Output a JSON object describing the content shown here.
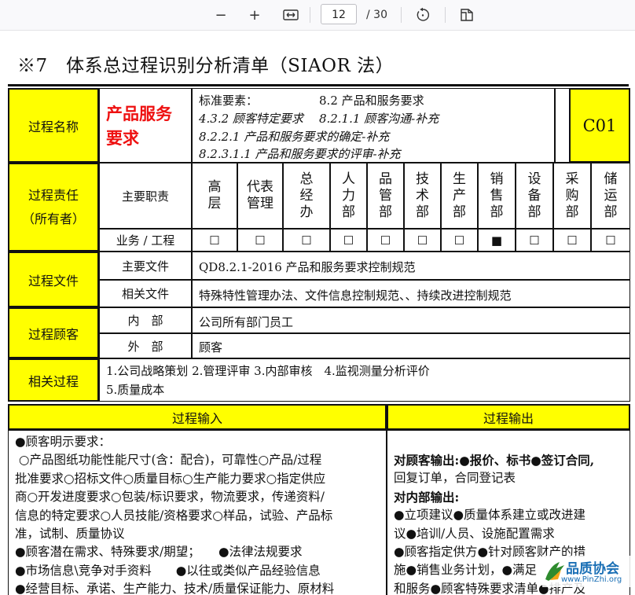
{
  "toolbar": {
    "zoom_out": "−",
    "zoom_in": "+",
    "current_page": "12",
    "total_pages": "/ 30"
  },
  "title": "※7　体系总过程识别分析清单（SIAOR 法）",
  "process_name": {
    "label": "过程名称",
    "name_line1": "产品服务",
    "name_line2": "要求",
    "std_label": "标准要素：",
    "std_main": "8.2 产品和服务要求",
    "std_line2a": "4.3.2 顾客特定要求",
    "std_line2b": "8.2.1.1 顾客沟通-补充",
    "std_line3": "8.2.2.1 产品和服务要求的确定-补充",
    "std_line4": "8.2.3.1.1 产品和服务要求的评审-补充",
    "code": "C01"
  },
  "responsibility": {
    "label_line1": "过程责任",
    "label_line2": "（所有者）",
    "main_duty": "主要职责",
    "business": "业务 / 工程",
    "depts": [
      {
        "name": "高层",
        "mark": "☐"
      },
      {
        "name": "代表 管理",
        "mark": "☐"
      },
      {
        "name": "总经办",
        "mark": "☐"
      },
      {
        "name": "人力部",
        "mark": "☐"
      },
      {
        "name": "品管部",
        "mark": "☐"
      },
      {
        "name": "技术部",
        "mark": "☐"
      },
      {
        "name": "生产部",
        "mark": "☐"
      },
      {
        "name": "销售部",
        "mark": "■"
      },
      {
        "name": "设备部",
        "mark": "☐"
      },
      {
        "name": "采购部",
        "mark": "☐"
      },
      {
        "name": "储运部",
        "mark": "☐"
      }
    ]
  },
  "files": {
    "label": "过程文件",
    "main_label": "主要文件",
    "main_value": "QD8.2.1-2016 产品和服务要求控制规范",
    "related_label": "相关文件",
    "related_value": "特殊特性管理办法、文件信息控制规范、、持续改进控制规范"
  },
  "customers": {
    "label": "过程顾客",
    "internal_label": "内　部",
    "internal_value": "公司所有部门员工",
    "external_label": "外　部",
    "external_value": "顾客"
  },
  "related": {
    "label": "相关过程",
    "line1": "1.公司战略策划 2.管理评审 3.内部审核　4.监视测量分析评价",
    "line2": "5.质量成本"
  },
  "input": {
    "header": "过程输入",
    "lines": [
      "●顾客明示要求：",
      " ○产品图纸功能性能尺寸(含：配合)，可靠性○产品/过程",
      "批准要求○招标文件○质量目标○生产能力要求○指定供应",
      "商○开发进度要求○包装/标识要求，物流要求，传递资料/",
      "信息的特定要求○人员技能/资格要求○样品，试验、产品标",
      "准，试制、质量协议",
      "●顾客潜在需求、特殊要求/期望；　　●法律法规要求",
      "●市场信息\\竞争对手资料　　●以往或类似产品经验信息",
      "●经营目标、承诺、生产能力、技术/质量保证能力、原材料"
    ]
  },
  "output": {
    "header": "过程输出",
    "lines": [
      "对顾客输出:●报价、标书●签订合同,",
      "回复订单，合同登记表",
      "对内部输出:",
      "●立项建议●质量体系建立或改进建",
      "议●培训/人员、设施配置需求",
      "●顾客指定供方●针对顾客财产的措",
      "施●销售业务计划，●满足",
      "和服务●顾客特殊要求清单●排产及"
    ]
  },
  "watermark": {
    "text": "品质协会",
    "url": "www.PinZhi.org"
  }
}
